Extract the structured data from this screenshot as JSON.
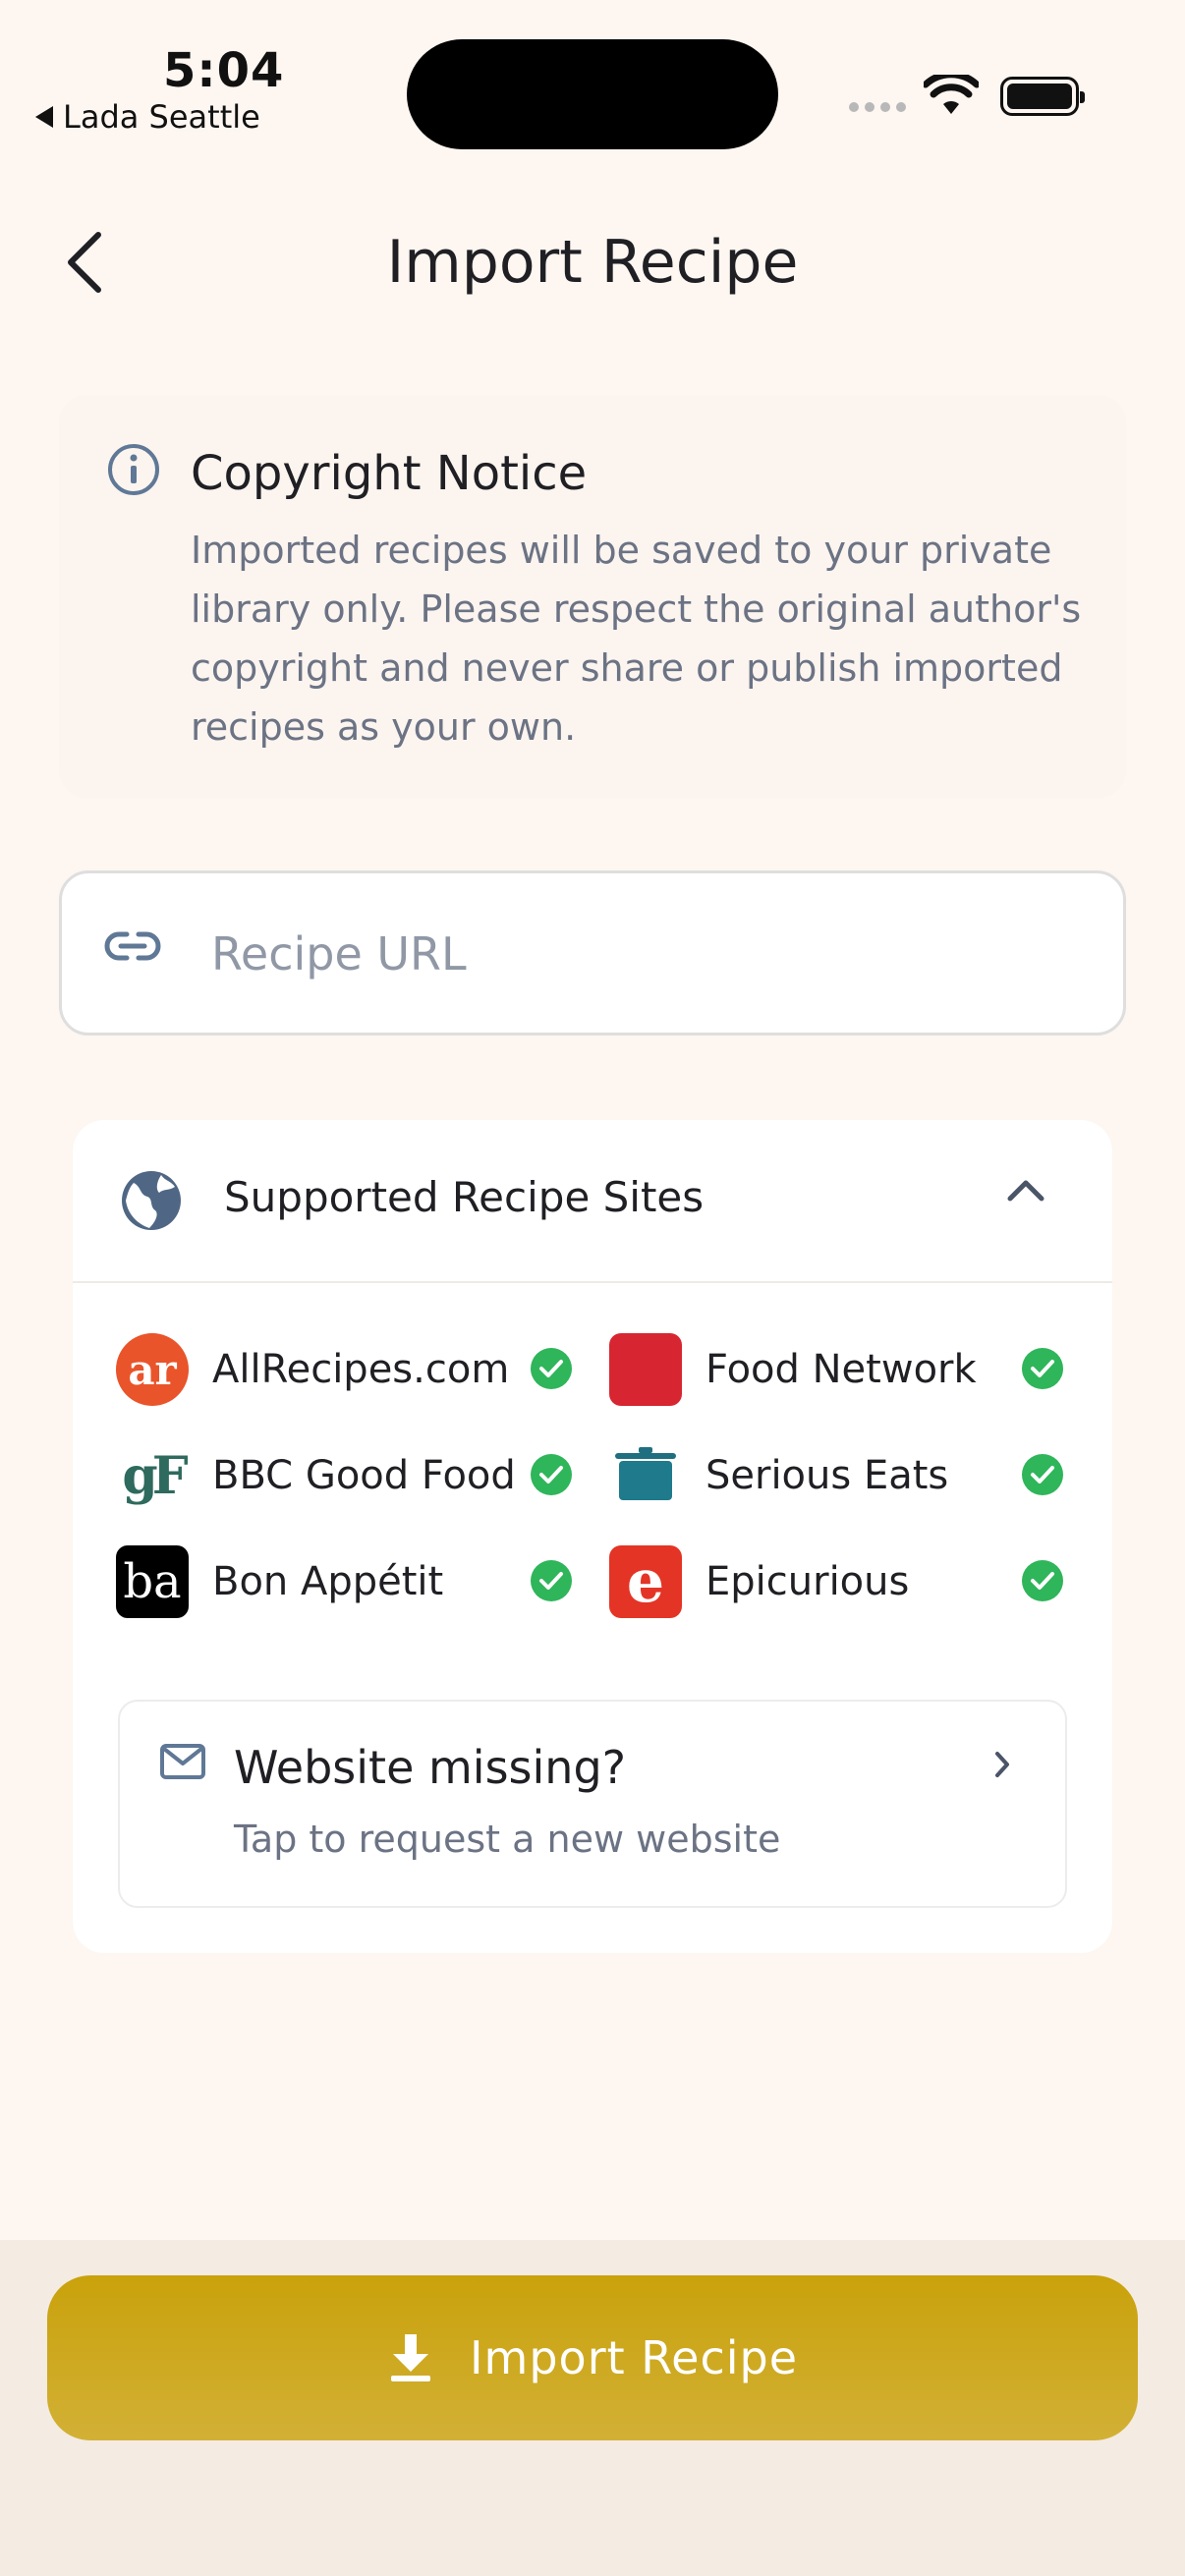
{
  "status_bar": {
    "time": "5:04",
    "back_app": "Lada Seattle"
  },
  "header": {
    "title": "Import Recipe"
  },
  "notice": {
    "title": "Copyright Notice",
    "body": "Imported recipes will be saved to your private library only. Please respect the original author's copyright and never share or publish imported recipes as your own."
  },
  "url_field": {
    "placeholder": "Recipe URL",
    "value": ""
  },
  "supported_sites": {
    "title": "Supported Recipe Sites",
    "expanded": true,
    "sites": [
      {
        "name": "AllRecipes.com",
        "logo_text": "ar",
        "supported": true
      },
      {
        "name": "Food Network",
        "logo_text": "",
        "supported": true
      },
      {
        "name": "BBC Good Food",
        "logo_text": "gF",
        "supported": true
      },
      {
        "name": "Serious Eats",
        "logo_text": "",
        "supported": true
      },
      {
        "name": "Bon Appétit",
        "logo_text": "ba",
        "supported": true
      },
      {
        "name": "Epicurious",
        "logo_text": "e",
        "supported": true
      }
    ],
    "missing": {
      "title": "Website missing?",
      "subtitle": "Tap to request a new website"
    }
  },
  "import_button": {
    "label": "Import Recipe"
  },
  "colors": {
    "accent": "#c9a20b",
    "check": "#2fb55a",
    "background": "#fdf6f1"
  }
}
